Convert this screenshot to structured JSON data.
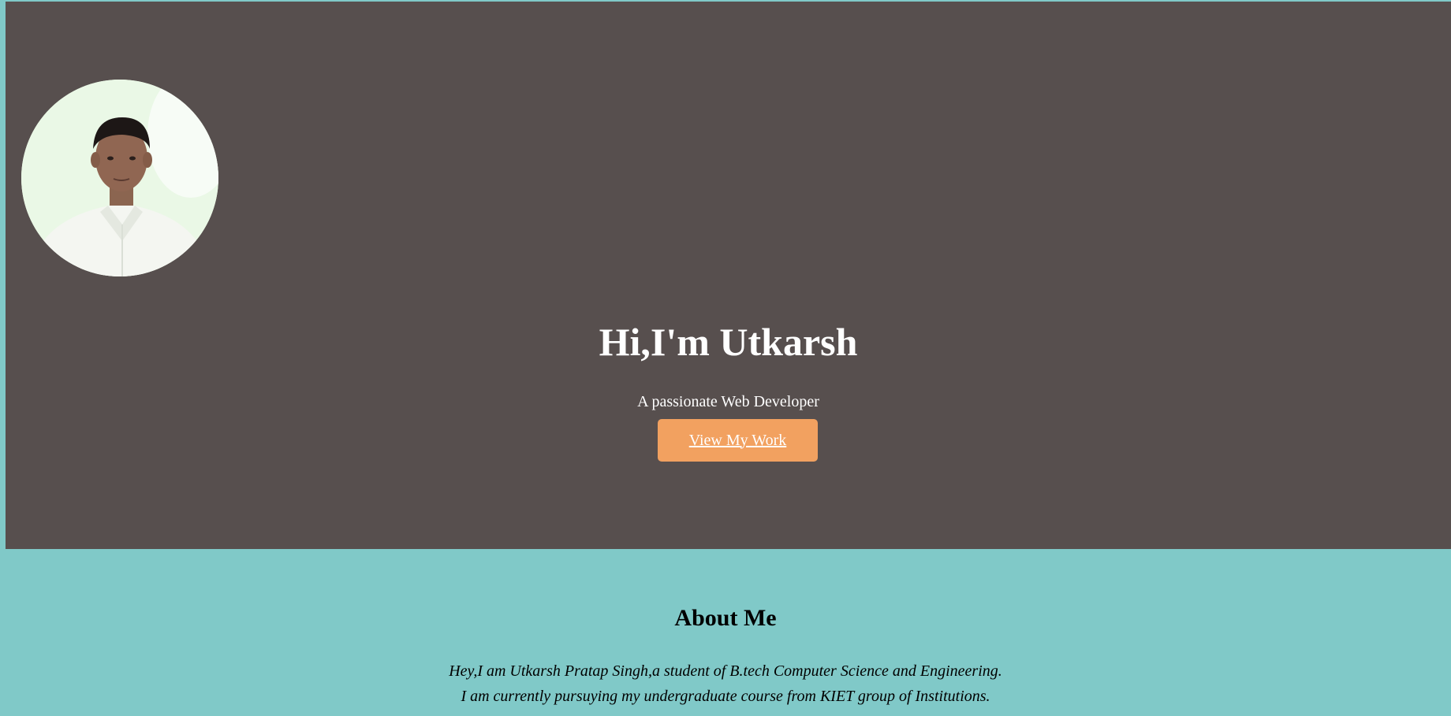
{
  "hero": {
    "avatar_icon": "profile-photo",
    "title": "Hi,I'm Utkarsh",
    "subtitle": "A passionate Web Developer",
    "cta_label": "View My Work"
  },
  "about": {
    "title": "About Me",
    "lines": [
      "Hey,I am Utkarsh Pratap Singh,a student of B.tech Computer Science and Engineering.",
      "I am currently pursuying my undergraduate course from KIET group of Institutions."
    ]
  },
  "colors": {
    "page_background": "#80c9c8",
    "hero_background": "#574f4e",
    "button_background": "#f2a160",
    "text_light": "#ffffff",
    "text_dark": "#000000"
  }
}
